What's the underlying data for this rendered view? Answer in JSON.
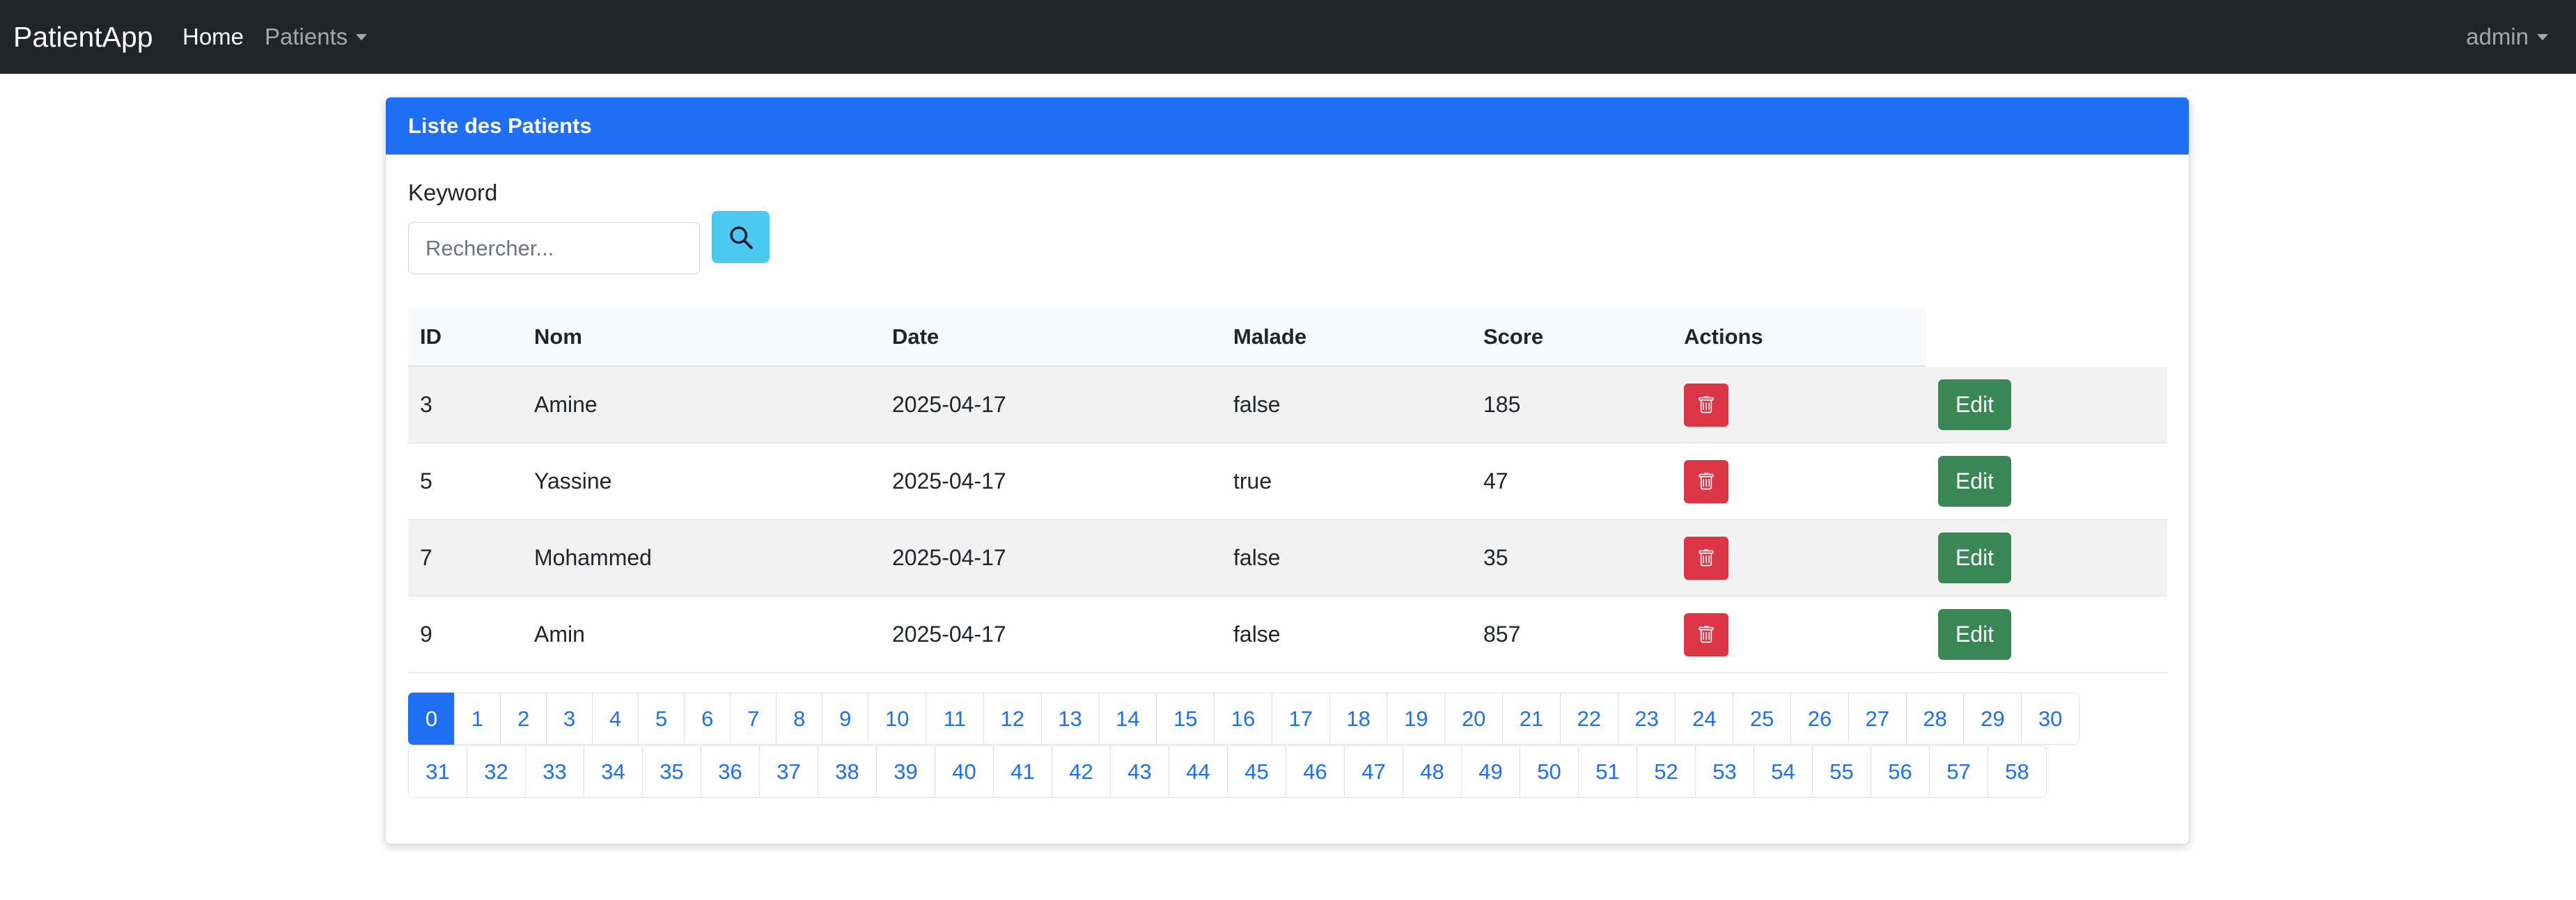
{
  "navbar": {
    "brand": "PatientApp",
    "home_label": "Home",
    "patients_label": "Patients",
    "user_label": "admin"
  },
  "card": {
    "title": "Liste des Patients",
    "keyword_label": "Keyword",
    "search_placeholder": "Rechercher...",
    "search_icon": "search-icon"
  },
  "table": {
    "headers": [
      "ID",
      "Nom",
      "Date",
      "Malade",
      "Score",
      "Actions"
    ],
    "rows": [
      {
        "id": "3",
        "nom": "Amine",
        "date": "2025-04-17",
        "malade": "false",
        "score": "185",
        "edit": "Edit"
      },
      {
        "id": "5",
        "nom": "Yassine",
        "date": "2025-04-17",
        "malade": "true",
        "score": "47",
        "edit": "Edit"
      },
      {
        "id": "7",
        "nom": "Mohammed",
        "date": "2025-04-17",
        "malade": "false",
        "score": "35",
        "edit": "Edit"
      },
      {
        "id": "9",
        "nom": "Amin",
        "date": "2025-04-17",
        "malade": "false",
        "score": "857",
        "edit": "Edit"
      }
    ]
  },
  "pagination": {
    "current": "0",
    "pages_row1": [
      "0",
      "1",
      "2",
      "3",
      "4",
      "5",
      "6",
      "7",
      "8",
      "9",
      "10",
      "11",
      "12",
      "13",
      "14",
      "15",
      "16",
      "17",
      "18",
      "19",
      "20",
      "21",
      "22",
      "23",
      "24",
      "25",
      "26",
      "27",
      "28",
      "29",
      "30"
    ],
    "pages_row2": [
      "31",
      "32",
      "33",
      "34",
      "35",
      "36",
      "37",
      "38",
      "39",
      "40",
      "41",
      "42",
      "43",
      "44",
      "45",
      "46",
      "47",
      "48",
      "49",
      "50",
      "51",
      "52",
      "53",
      "54",
      "55",
      "56",
      "57",
      "58"
    ]
  },
  "colors": {
    "primary": "#1f6ff5",
    "navbar": "#212529",
    "info": "#4cc9f0",
    "danger": "#dc3545",
    "success": "#3a8756"
  }
}
